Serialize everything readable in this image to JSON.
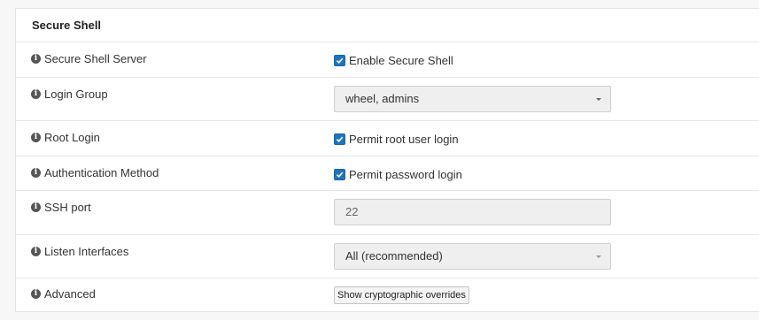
{
  "panel": {
    "title": "Secure Shell"
  },
  "rows": {
    "ssh_server": {
      "label": "Secure Shell Server",
      "checkbox_label": "Enable Secure Shell",
      "checked": true
    },
    "login_group": {
      "label": "Login Group",
      "value": "wheel, admins"
    },
    "root_login": {
      "label": "Root Login",
      "checkbox_label": "Permit root user login",
      "checked": true
    },
    "auth_method": {
      "label": "Authentication Method",
      "checkbox_label": "Permit password login",
      "checked": true
    },
    "ssh_port": {
      "label": "SSH port",
      "value": "22"
    },
    "listen_interfaces": {
      "label": "Listen Interfaces",
      "value": "All (recommended)"
    },
    "advanced": {
      "label": "Advanced",
      "button_label": "Show cryptographic overrides"
    }
  },
  "icons": {
    "info": "info-circle-icon",
    "check": "check-icon",
    "dropdown": "chevron-down-icon"
  },
  "colors": {
    "checkbox": "#1e73be",
    "field_bg": "#efefef"
  }
}
